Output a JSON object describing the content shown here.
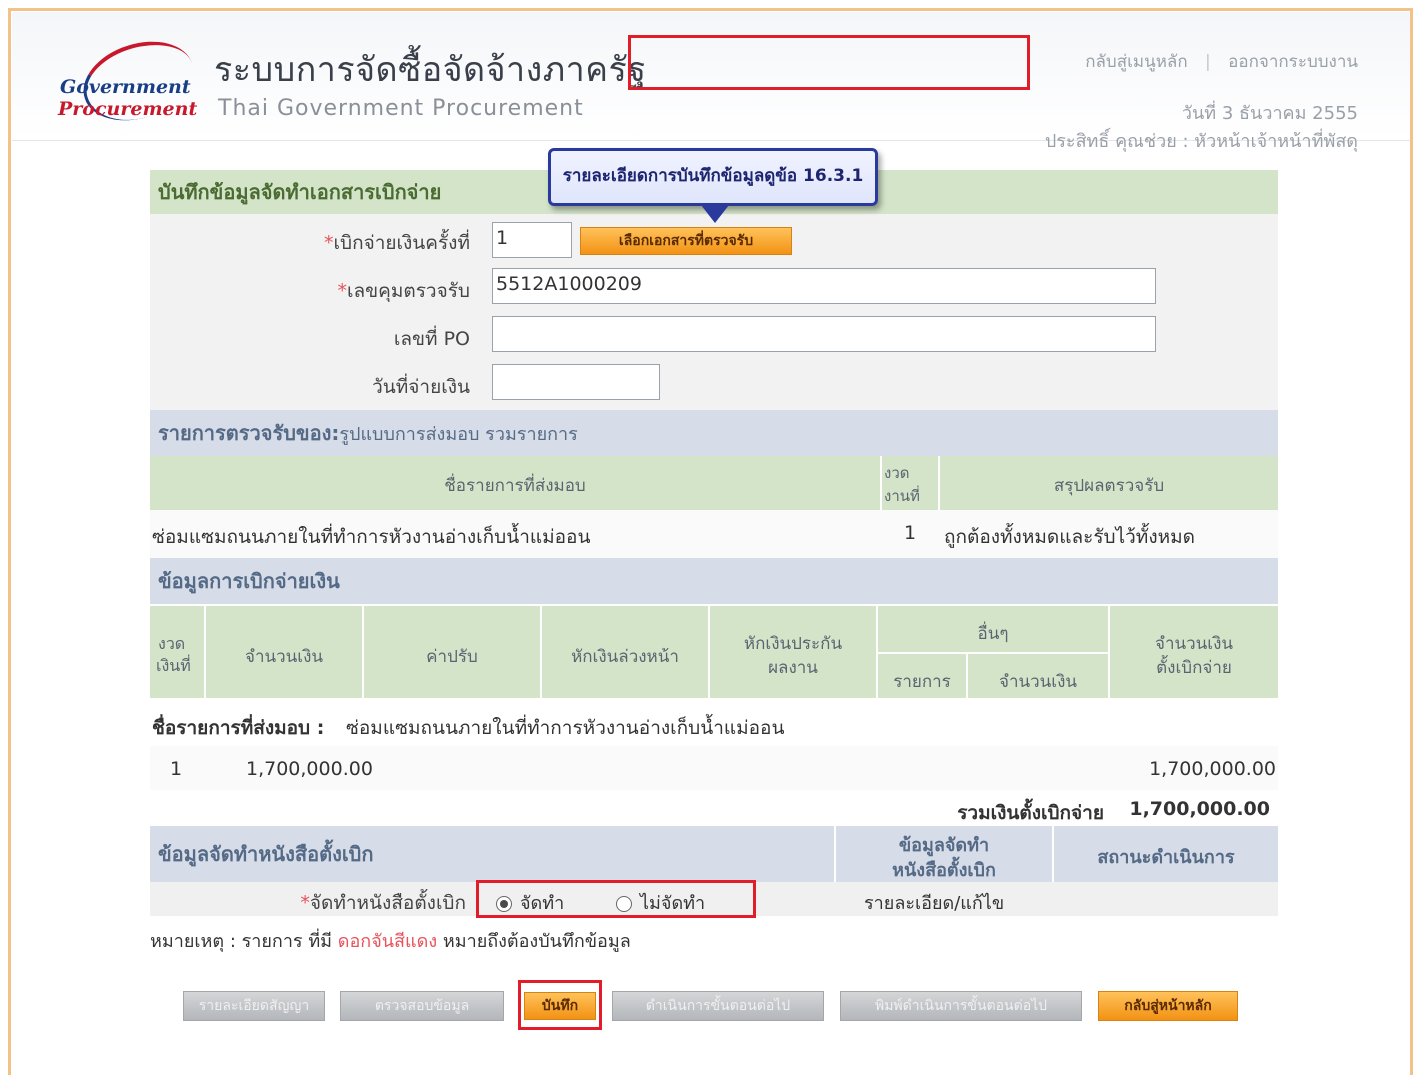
{
  "header": {
    "logo_line1": "Government",
    "logo_line2": "Procurement",
    "title_th": "ระบบการจัดซื้อจัดจ้างภาครัฐ",
    "title_en": "Thai Government Procurement",
    "link_main_menu": "กลับสู่เมนูหลัก",
    "link_logout": "ออกจากระบบงาน",
    "date": "วันที่ 3 ธันวาคม 2555",
    "user": "ประสิทธิ์ คุณช่วย : หัวหน้าเจ้าหน้าที่พัสดุ"
  },
  "callout": "รายละเอียดการบันทึกข้อมูลดูข้อ 16.3.1",
  "form": {
    "section_title": "บันทึกข้อมูลจัดทำเอกสารเบิกจ่าย",
    "installment_label": "เบิกจ่ายเงินครั้งที่",
    "installment_value": "1",
    "select_doc_button": "เลือกเอกสารที่ตรวจรับ",
    "inspection_no_label": "เลขคุมตรวจรับ",
    "inspection_no_value": "5512A1000209",
    "po_label": "เลขที่ PO",
    "po_value": "",
    "pay_date_label": "วันที่จ่ายเงิน",
    "pay_date_value": ""
  },
  "inspection": {
    "section_title": "รายการตรวจรับของ:",
    "section_subtitle": "รูปแบบการส่งมอบ รวมรายการ",
    "col_item": "ชื่อรายการที่ส่งมอบ",
    "col_installment_1": "งวด",
    "col_installment_2": "งานที่",
    "col_result": "สรุปผลตรวจรับ",
    "row_item": "ซ่อมแซมถนนภายในที่ทำการหัวงานอ่างเก็บน้ำแม่ออน",
    "row_installment": "1",
    "row_result": "ถูกต้องทั้งหมดและรับไว้ทั้งหมด"
  },
  "payment": {
    "section_title": "ข้อมูลการเบิกจ่ายเงิน",
    "col_inst_1": "งวด",
    "col_inst_2": "เงินที่",
    "col_amount": "จำนวนเงิน",
    "col_fine": "ค่าปรับ",
    "col_advance": "หักเงินล่วงหน้า",
    "col_guarantee_1": "หักเงินประกัน",
    "col_guarantee_2": "ผลงาน",
    "col_other": "อื่นๆ",
    "col_other_item": "รายการ",
    "col_other_amount": "จำนวนเงิน",
    "col_total_1": "จำนวนเงิน",
    "col_total_2": "ตั้งเบิกจ่าย",
    "item_label": "ชื่อรายการที่ส่งมอบ :",
    "item_name": "ซ่อมแซมถนนภายในที่ทำการหัวงานอ่างเก็บน้ำแม่ออน",
    "row_inst": "1",
    "row_amount": "1,700,000.00",
    "row_total": "1,700,000.00",
    "sum_label": "รวมเงินตั้งเบิกจ่าย",
    "sum_value": "1,700,000.00"
  },
  "letter": {
    "section_title": "ข้อมูลจัดทำหนังสือตั้งเบิก",
    "col_info_1": "ข้อมูลจัดทำ",
    "col_info_2": "หนังสือตั้งเบิก",
    "col_status": "สถานะดำเนินการ",
    "field_label": "จัดทำหนังสือตั้งเบิก",
    "option_make": "จัดทำ",
    "option_not_make": "ไม่จัดทำ",
    "selected": "จัดทำ",
    "detail_link": "รายละเอียด/แก้ไข"
  },
  "note": {
    "prefix": "หมายเหตุ : รายการ ที่มี",
    "red_text": "ดอกจันสีแดง",
    "suffix": "หมายถึงต้องบันทึกข้อมูล"
  },
  "buttons": {
    "detail_contract": "รายละเอียดสัญญา",
    "check_data": "ตรวจสอบข้อมูล",
    "save": "บันทึก",
    "next_step": "ดำเนินการขั้นตอนต่อไป",
    "print_next": "พิมพ์ดำเนินการขั้นตอนต่อไป",
    "back_home": "กลับสู่หน้าหลัก"
  },
  "colors": {
    "accent_red": "#e11d2a",
    "section_green": "#d3e4c9",
    "section_blue": "#d7dde8",
    "button_orange": "#f29214"
  }
}
